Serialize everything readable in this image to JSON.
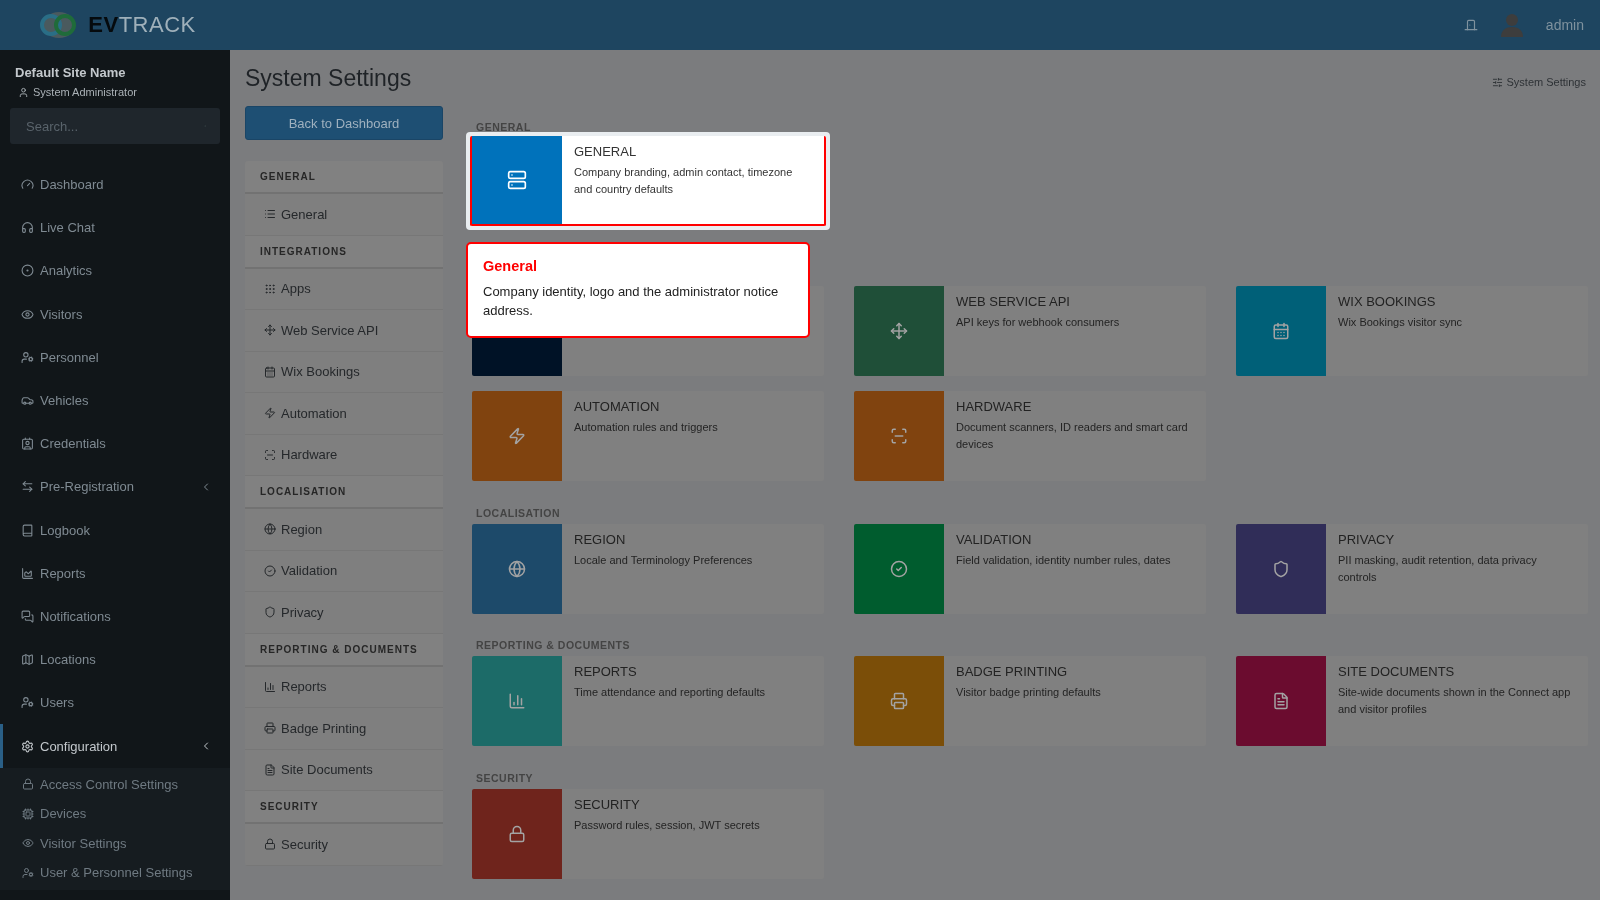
{
  "header": {
    "logo": {
      "bold": "EV",
      "light": "TRACK"
    },
    "user": "admin"
  },
  "sidebar": {
    "site_name": "Default Site Name",
    "role": "System Administrator",
    "search": {
      "placeholder": "Search..."
    },
    "items": [
      {
        "label": "Dashboard",
        "selected": false,
        "has_children": false
      },
      {
        "label": "Live Chat",
        "selected": false,
        "has_children": false
      },
      {
        "label": "Analytics",
        "selected": false,
        "has_children": false
      },
      {
        "label": "Visitors",
        "selected": false,
        "has_children": false
      },
      {
        "label": "Personnel",
        "selected": false,
        "has_children": false
      },
      {
        "label": "Vehicles",
        "selected": false,
        "has_children": false
      },
      {
        "label": "Credentials",
        "selected": false,
        "has_children": false
      },
      {
        "label": "Pre-Registration",
        "selected": false,
        "has_children": true
      },
      {
        "label": "Logbook",
        "selected": false,
        "has_children": false
      },
      {
        "label": "Reports",
        "selected": false,
        "has_children": false
      },
      {
        "label": "Notifications",
        "selected": false,
        "has_children": false
      },
      {
        "label": "Locations",
        "selected": false,
        "has_children": false
      },
      {
        "label": "Users",
        "selected": false,
        "has_children": false
      },
      {
        "label": "Configuration",
        "selected": true,
        "has_children": true,
        "children": [
          {
            "label": "Access Control Settings"
          },
          {
            "label": "Devices"
          },
          {
            "label": "Visitor Settings"
          },
          {
            "label": "User & Personnel Settings"
          }
        ]
      }
    ]
  },
  "page": {
    "title": "System Settings",
    "breadcrumb": "System Settings",
    "back_button": "Back to Dashboard"
  },
  "settings_nav": [
    {
      "heading": "GENERAL",
      "items": [
        "General"
      ]
    },
    {
      "heading": "INTEGRATIONS",
      "items": [
        "Apps",
        "Web Service API",
        "Wix Bookings",
        "Automation",
        "Hardware"
      ]
    },
    {
      "heading": "LOCALISATION",
      "items": [
        "Region",
        "Validation",
        "Privacy"
      ]
    },
    {
      "heading": "REPORTING & DOCUMENTS",
      "items": [
        "Reports",
        "Badge Printing",
        "Site Documents"
      ]
    },
    {
      "heading": "SECURITY",
      "items": [
        "Security"
      ]
    }
  ],
  "sections": [
    {
      "heading": "GENERAL",
      "cards": [
        {
          "title": "GENERAL",
          "description": "Company branding, admin contact, timezone and country defaults",
          "color": "#0072bb",
          "highlighted": true
        }
      ]
    },
    {
      "cards": [
        {
          "color": "#001226",
          "highlighted": false
        },
        {
          "title": "WEB SERVICE API",
          "description": "API keys for webhook consumers",
          "color": "#1f4f38",
          "highlighted": false
        },
        {
          "title": "WIX BOOKINGS",
          "description": "Wix Bookings visitor sync",
          "color": "#006078",
          "highlighted": false
        },
        {
          "title": "AUTOMATION",
          "description": "Automation rules and triggers",
          "color": "#80430f",
          "highlighted": false
        },
        {
          "title": "HARDWARE",
          "description": "Document scanners, ID readers and smart card devices",
          "color": "#80430f",
          "highlighted": false
        }
      ]
    },
    {
      "heading": "LOCALISATION",
      "cards": [
        {
          "title": "REGION",
          "description": "Locale and Terminology Preferences",
          "color": "#1d4a6a",
          "highlighted": false
        },
        {
          "title": "VALIDATION",
          "description": "Field validation, identity number rules, dates",
          "color": "#005c2e",
          "highlighted": false
        },
        {
          "title": "PRIVACY",
          "description": "PII masking, audit retention, data privacy controls",
          "color": "#302d58",
          "highlighted": false
        }
      ]
    },
    {
      "heading": "REPORTING & DOCUMENTS",
      "cards": [
        {
          "title": "REPORTS",
          "description": "Time attendance and reporting defaults",
          "color": "#1c6b68",
          "highlighted": false
        },
        {
          "title": "BADGE PRINTING",
          "description": "Visitor badge printing defaults",
          "color": "#7b4e08",
          "highlighted": false
        },
        {
          "title": "SITE DOCUMENTS",
          "description": "Site-wide documents shown in the Connect app and visitor profiles",
          "color": "#6b0c2f",
          "highlighted": false
        }
      ]
    },
    {
      "heading": "SECURITY",
      "cards": [
        {
          "title": "SECURITY",
          "description": "Password rules, session, JWT secrets",
          "color": "#6f241c",
          "highlighted": false
        }
      ]
    }
  ],
  "tour": {
    "title": "General",
    "text": "Company identity, logo and the administrator notice address."
  }
}
